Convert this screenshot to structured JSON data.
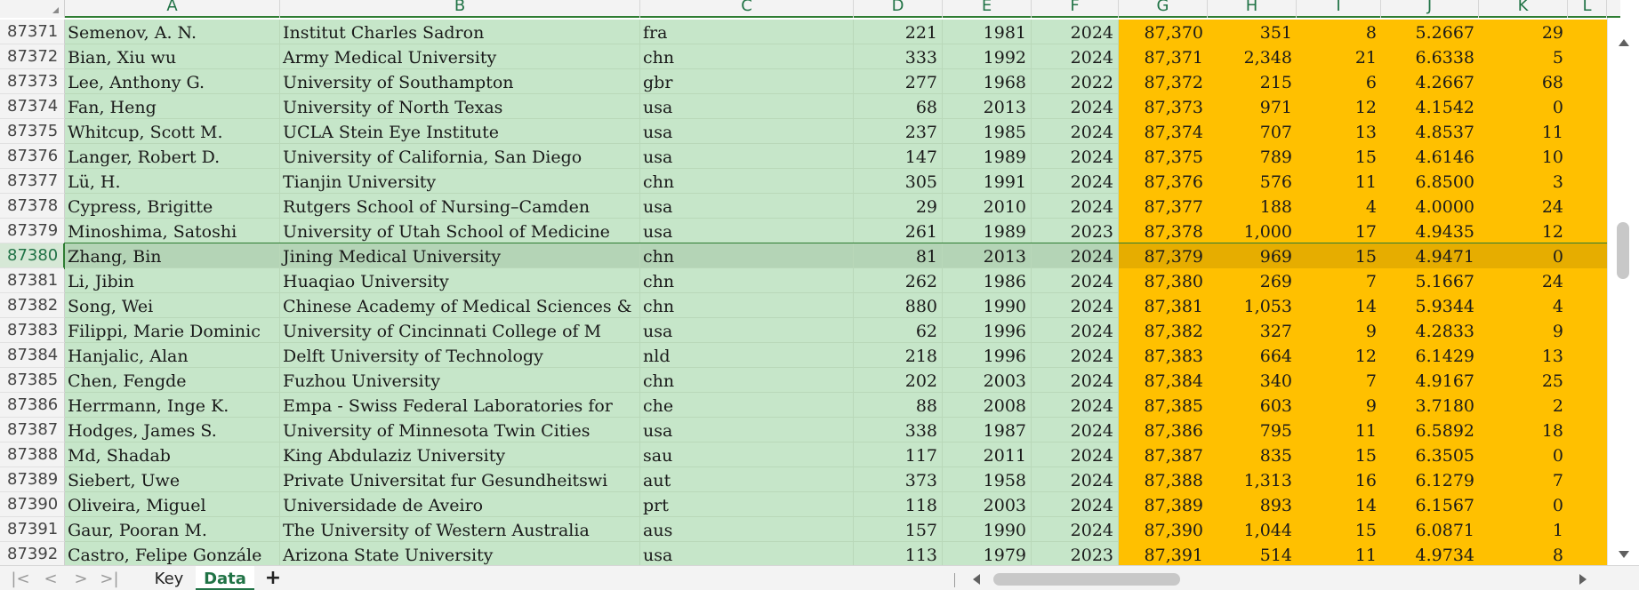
{
  "columns": [
    "A",
    "B",
    "C",
    "D",
    "E",
    "F",
    "G",
    "H",
    "I",
    "J",
    "K",
    "L"
  ],
  "active_row": "87380",
  "rows": [
    {
      "num": "87371",
      "a": "Semenov, A. N.",
      "b": "Institut Charles Sadron",
      "c": "fra",
      "d": "221",
      "e": "1981",
      "f": "2024",
      "g": "87,370",
      "h": "351",
      "i": "8",
      "j": "5.2667",
      "k": "29"
    },
    {
      "num": "87372",
      "a": "Bian, Xiu wu",
      "b": "Army Medical University",
      "c": "chn",
      "d": "333",
      "e": "1992",
      "f": "2024",
      "g": "87,371",
      "h": "2,348",
      "i": "21",
      "j": "6.6338",
      "k": "5"
    },
    {
      "num": "87373",
      "a": "Lee, Anthony G.",
      "b": "University of Southampton",
      "c": "gbr",
      "d": "277",
      "e": "1968",
      "f": "2022",
      "g": "87,372",
      "h": "215",
      "i": "6",
      "j": "4.2667",
      "k": "68"
    },
    {
      "num": "87374",
      "a": "Fan, Heng",
      "b": "University of North Texas",
      "c": "usa",
      "d": "68",
      "e": "2013",
      "f": "2024",
      "g": "87,373",
      "h": "971",
      "i": "12",
      "j": "4.1542",
      "k": "0"
    },
    {
      "num": "87375",
      "a": "Whitcup, Scott M.",
      "b": "UCLA Stein Eye Institute",
      "c": "usa",
      "d": "237",
      "e": "1985",
      "f": "2024",
      "g": "87,374",
      "h": "707",
      "i": "13",
      "j": "4.8537",
      "k": "11"
    },
    {
      "num": "87376",
      "a": "Langer, Robert D.",
      "b": "University of California, San Diego",
      "c": "usa",
      "d": "147",
      "e": "1989",
      "f": "2024",
      "g": "87,375",
      "h": "789",
      "i": "15",
      "j": "4.6146",
      "k": "10"
    },
    {
      "num": "87377",
      "a": "Lü, H.",
      "b": "Tianjin University",
      "c": "chn",
      "d": "305",
      "e": "1991",
      "f": "2024",
      "g": "87,376",
      "h": "576",
      "i": "11",
      "j": "6.8500",
      "k": "3"
    },
    {
      "num": "87378",
      "a": "Cypress, Brigitte",
      "b": "Rutgers School of Nursing–Camden",
      "c": "usa",
      "d": "29",
      "e": "2010",
      "f": "2024",
      "g": "87,377",
      "h": "188",
      "i": "4",
      "j": "4.0000",
      "k": "24"
    },
    {
      "num": "87379",
      "a": "Minoshima, Satoshi",
      "b": "University of Utah School of Medicine",
      "c": "usa",
      "d": "261",
      "e": "1989",
      "f": "2023",
      "g": "87,378",
      "h": "1,000",
      "i": "17",
      "j": "4.9435",
      "k": "12"
    },
    {
      "num": "87380",
      "a": "Zhang, Bin",
      "b": "Jining Medical University",
      "c": "chn",
      "d": "81",
      "e": "2013",
      "f": "2024",
      "g": "87,379",
      "h": "969",
      "i": "15",
      "j": "4.9471",
      "k": "0"
    },
    {
      "num": "87381",
      "a": "Li, Jibin",
      "b": "Huaqiao University",
      "c": "chn",
      "d": "262",
      "e": "1986",
      "f": "2024",
      "g": "87,380",
      "h": "269",
      "i": "7",
      "j": "5.1667",
      "k": "24"
    },
    {
      "num": "87382",
      "a": "Song, Wei",
      "b": "Chinese Academy of Medical Sciences &",
      "c": "chn",
      "d": "880",
      "e": "1990",
      "f": "2024",
      "g": "87,381",
      "h": "1,053",
      "i": "14",
      "j": "5.9344",
      "k": "4"
    },
    {
      "num": "87383",
      "a": "Filippi, Marie Dominic",
      "b": "University of Cincinnati College of M",
      "c": "usa",
      "d": "62",
      "e": "1996",
      "f": "2024",
      "g": "87,382",
      "h": "327",
      "i": "9",
      "j": "4.2833",
      "k": "9"
    },
    {
      "num": "87384",
      "a": "Hanjalic, Alan",
      "b": "Delft University of Technology",
      "c": "nld",
      "d": "218",
      "e": "1996",
      "f": "2024",
      "g": "87,383",
      "h": "664",
      "i": "12",
      "j": "6.1429",
      "k": "13"
    },
    {
      "num": "87385",
      "a": "Chen, Fengde",
      "b": "Fuzhou University",
      "c": "chn",
      "d": "202",
      "e": "2003",
      "f": "2024",
      "g": "87,384",
      "h": "340",
      "i": "7",
      "j": "4.9167",
      "k": "25"
    },
    {
      "num": "87386",
      "a": "Herrmann, Inge K.",
      "b": "Empa - Swiss Federal Laboratories for",
      "c": "che",
      "d": "88",
      "e": "2008",
      "f": "2024",
      "g": "87,385",
      "h": "603",
      "i": "9",
      "j": "3.7180",
      "k": "2"
    },
    {
      "num": "87387",
      "a": "Hodges, James S.",
      "b": "University of Minnesota Twin Cities",
      "c": "usa",
      "d": "338",
      "e": "1987",
      "f": "2024",
      "g": "87,386",
      "h": "795",
      "i": "11",
      "j": "6.5892",
      "k": "18"
    },
    {
      "num": "87388",
      "a": "Md, Shadab",
      "b": "King Abdulaziz University",
      "c": "sau",
      "d": "117",
      "e": "2011",
      "f": "2024",
      "g": "87,387",
      "h": "835",
      "i": "15",
      "j": "6.3505",
      "k": "0"
    },
    {
      "num": "87389",
      "a": "Siebert, Uwe",
      "b": "Private Universitat fur Gesundheitswi",
      "c": "aut",
      "d": "373",
      "e": "1958",
      "f": "2024",
      "g": "87,388",
      "h": "1,313",
      "i": "16",
      "j": "6.1279",
      "k": "7"
    },
    {
      "num": "87390",
      "a": "Oliveira, Miguel",
      "b": "Universidade de Aveiro",
      "c": "prt",
      "d": "118",
      "e": "2003",
      "f": "2024",
      "g": "87,389",
      "h": "893",
      "i": "14",
      "j": "6.1567",
      "k": "0"
    },
    {
      "num": "87391",
      "a": "Gaur, Pooran M.",
      "b": "The University of Western Australia",
      "c": "aus",
      "d": "157",
      "e": "1990",
      "f": "2024",
      "g": "87,390",
      "h": "1,044",
      "i": "15",
      "j": "6.0871",
      "k": "1"
    },
    {
      "num": "87392",
      "a": "Castro, Felipe Gonzále",
      "b": "Arizona State University",
      "c": "usa",
      "d": "113",
      "e": "1979",
      "f": "2023",
      "g": "87,391",
      "h": "514",
      "i": "11",
      "j": "4.9734",
      "k": "8"
    }
  ],
  "tabs": [
    {
      "label": "Key",
      "active": false
    },
    {
      "label": "Data",
      "active": true
    }
  ],
  "nav": {
    "first": "|<",
    "prev": "<",
    "next": ">",
    "last": ">|",
    "add_tab": "+"
  },
  "colors": {
    "green_fill": "#c6e6c9",
    "orange_fill": "#ffc000",
    "accent": "#217346"
  }
}
